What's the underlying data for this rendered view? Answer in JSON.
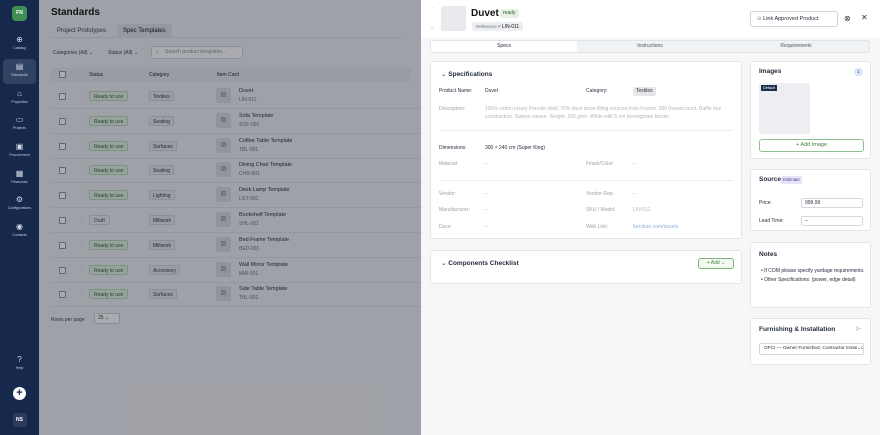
{
  "sidebar": {
    "logo": "FN",
    "items": [
      {
        "label": "Catalog",
        "icon": "catalog-icon",
        "glyph": "⊕"
      },
      {
        "label": "Standards",
        "icon": "standards-icon",
        "glyph": "▤"
      },
      {
        "label": "Properties",
        "icon": "properties-icon",
        "glyph": "⌂"
      },
      {
        "label": "Projects",
        "icon": "projects-icon",
        "glyph": "▭"
      },
      {
        "label": "Procurement",
        "icon": "procurement-icon",
        "glyph": "▣"
      },
      {
        "label": "Financials",
        "icon": "financials-icon",
        "glyph": "▦"
      },
      {
        "label": "Configurations",
        "icon": "configurations-icon",
        "glyph": "⚙"
      },
      {
        "label": "Contacts",
        "icon": "contacts-icon",
        "glyph": "◉"
      }
    ],
    "help": "Help",
    "user": "NS"
  },
  "page": {
    "title": "Standards",
    "tabs": [
      "Project Prototypes",
      "Spec Templates"
    ],
    "filters": {
      "categories": "Categories (All)",
      "status": "Status (All)"
    },
    "search_placeholder": "Search product templates..."
  },
  "table": {
    "headers": [
      "Status",
      "Category",
      "Item Card"
    ],
    "rows": [
      {
        "status": "Ready to use",
        "category": "Textiles",
        "name": "Duvet",
        "code": "LIN-011"
      },
      {
        "status": "Ready to use",
        "category": "Seating",
        "name": "Sofa Template",
        "code": "SOF-001"
      },
      {
        "status": "Ready to use",
        "category": "Surfaces",
        "name": "Coffee Table Template",
        "code": "TBL-001"
      },
      {
        "status": "Ready to use",
        "category": "Seating",
        "name": "Dining Chair Template",
        "code": "CHR-001"
      },
      {
        "status": "Ready to use",
        "category": "Lighting",
        "name": "Desk Lamp Template",
        "code": "LGT-001"
      },
      {
        "status": "Draft",
        "category": "Millwork",
        "name": "Bookshelf Template",
        "code": "SHL-001"
      },
      {
        "status": "Ready to use",
        "category": "Millwork",
        "name": "Bed Frame Template",
        "code": "BED-001"
      },
      {
        "status": "Ready to use",
        "category": "Accessory",
        "name": "Wall Mirror Template",
        "code": "MIR-001"
      },
      {
        "status": "Ready to use",
        "category": "Surfaces",
        "name": "Side Table Template",
        "code": "TBL-002"
      }
    ],
    "rows_per_page_label": "Rows per page",
    "rows_per_page": "25"
  },
  "panel": {
    "title": "Duvet",
    "status": "ready",
    "ref_label": "Reference #",
    "ref": "LIN-011",
    "link_button": "Link Approved Product",
    "tabs": [
      "Specs",
      "Instructions",
      "Requirements"
    ],
    "specs": {
      "heading": "Specifications",
      "product_name_label": "Product Name:",
      "product_name": "Duvet",
      "category_label": "Category:",
      "category": "Textiles",
      "description_label": "Description:",
      "description": "100% cotton luxury Percale shell, 70% duck down filling sourced from France. 300 thread count. Baffle box construction. Sateen weave. Weight: 200 g/m². White with 5 cm herringbone border.",
      "dimensions_label": "Dimensions:",
      "dimensions": "300 × 240 cm (Super King)",
      "material_label": "Material:",
      "material": "–",
      "finish_label": "Finish/Color:",
      "finish": "–",
      "vendor_label": "Vendor:",
      "vendor": "–",
      "vendor_rep_label": "Vendor Rep:",
      "vendor_rep": "–",
      "manufacturer_label": "Manufacturer:",
      "manufacturer": "–",
      "sku_label": "SKU / Model:",
      "sku": "LIN-011",
      "docs_label": "Docs:",
      "docs": "–",
      "web_label": "Web Link:",
      "web": "furniture.com/duvets"
    },
    "checklist": {
      "heading": "Components Checklist",
      "add": "Add"
    },
    "images": {
      "heading": "Images",
      "count": "1",
      "default_tag": "Default",
      "add": "Add Image"
    },
    "source": {
      "heading": "Source",
      "badge": "Estimate",
      "price_label": "Price:",
      "price": "999.99",
      "lead_label": "Lead Time:",
      "lead": "–"
    },
    "notes": {
      "heading": "Notes",
      "items": [
        "If COM please specify yardage requirements.",
        "Other Specifications: (power, edge detail)"
      ]
    },
    "furnishing": {
      "heading": "Furnishing & Installation",
      "value": "OFCI — Owner Furnished, Contractor Installed"
    }
  }
}
